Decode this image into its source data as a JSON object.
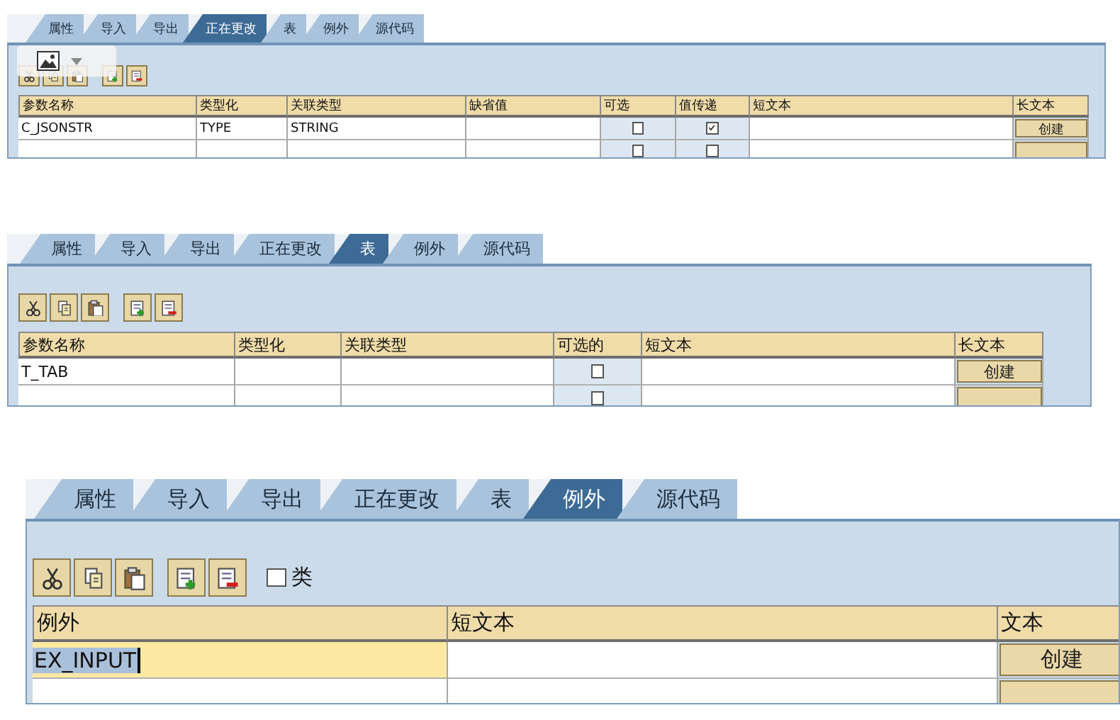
{
  "panels": [
    {
      "tabs": [
        {
          "label": "属性",
          "selected": false
        },
        {
          "label": "导入",
          "selected": false
        },
        {
          "label": "导出",
          "selected": false
        },
        {
          "label": "正在更改",
          "selected": true
        },
        {
          "label": "表",
          "selected": false
        },
        {
          "label": "例外",
          "selected": false
        },
        {
          "label": "源代码",
          "selected": false
        }
      ],
      "table": {
        "columns": [
          "参数名称",
          "类型化",
          "关联类型",
          "缺省值",
          "可选",
          "值传递",
          "短文本",
          "长文本"
        ],
        "rows": [
          {
            "cells": [
              {
                "kind": "text",
                "text": "C_JSONSTR"
              },
              {
                "kind": "text",
                "text": "TYPE"
              },
              {
                "kind": "text",
                "text": "STRING"
              },
              {
                "kind": "text"
              },
              {
                "kind": "checkbox",
                "checked": false
              },
              {
                "kind": "checkbox",
                "checked": true
              },
              {
                "kind": "text"
              },
              {
                "kind": "button",
                "label": "创建"
              }
            ]
          },
          {
            "cells": [
              {
                "kind": "text"
              },
              {
                "kind": "text"
              },
              {
                "kind": "text"
              },
              {
                "kind": "text"
              },
              {
                "kind": "checkbox",
                "checked": false
              },
              {
                "kind": "checkbox",
                "checked": false
              },
              {
                "kind": "text"
              },
              {
                "kind": "button"
              }
            ]
          }
        ]
      }
    },
    {
      "tabs": [
        {
          "label": "属性",
          "selected": false
        },
        {
          "label": "导入",
          "selected": false
        },
        {
          "label": "导出",
          "selected": false
        },
        {
          "label": "正在更改",
          "selected": false
        },
        {
          "label": "表",
          "selected": true
        },
        {
          "label": "例外",
          "selected": false
        },
        {
          "label": "源代码",
          "selected": false
        }
      ],
      "table": {
        "columns": [
          "参数名称",
          "类型化",
          "关联类型",
          "可选的",
          "短文本",
          "长文本"
        ],
        "rows": [
          {
            "cells": [
              {
                "kind": "text",
                "text": "T_TAB"
              },
              {
                "kind": "text"
              },
              {
                "kind": "text"
              },
              {
                "kind": "checkbox",
                "checked": false
              },
              {
                "kind": "text"
              },
              {
                "kind": "button",
                "label": "创建"
              }
            ]
          },
          {
            "cells": [
              {
                "kind": "text"
              },
              {
                "kind": "text"
              },
              {
                "kind": "text"
              },
              {
                "kind": "checkbox",
                "checked": false
              },
              {
                "kind": "text"
              },
              {
                "kind": "button"
              }
            ]
          }
        ]
      }
    },
    {
      "tabs": [
        {
          "label": "属性",
          "selected": false
        },
        {
          "label": "导入",
          "selected": false
        },
        {
          "label": "导出",
          "selected": false
        },
        {
          "label": "正在更改",
          "selected": false
        },
        {
          "label": "表",
          "selected": false
        },
        {
          "label": "例外",
          "selected": true
        },
        {
          "label": "源代码",
          "selected": false
        }
      ],
      "class_option": {
        "label": "类",
        "checked": false
      },
      "table": {
        "columns": [
          "例外",
          "短文本",
          "文本"
        ],
        "rows": [
          {
            "cells": [
              {
                "kind": "input",
                "value": "EX_INPUT",
                "focused": true
              },
              {
                "kind": "text"
              },
              {
                "kind": "button",
                "label": "创建"
              }
            ]
          },
          {
            "cells": [
              {
                "kind": "text"
              },
              {
                "kind": "text"
              },
              {
                "kind": "button"
              }
            ]
          }
        ]
      }
    }
  ]
}
